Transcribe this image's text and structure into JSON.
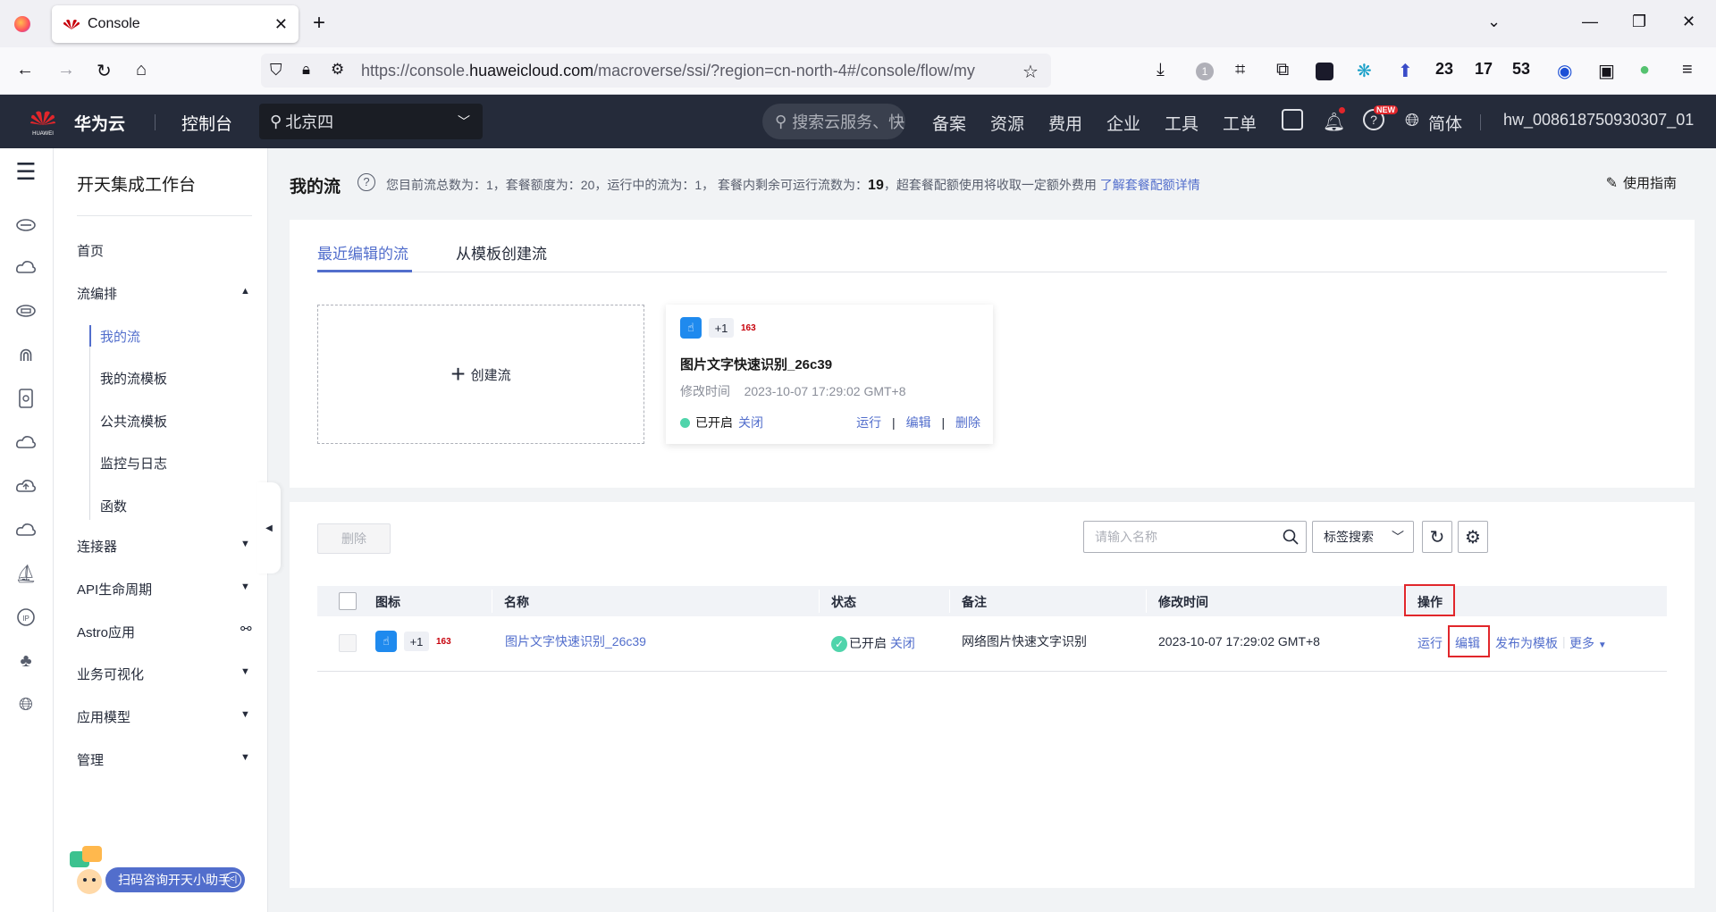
{
  "browser": {
    "tab_title": "Console",
    "url_prefix": "https://console.",
    "url_domain": "huaweicloud.com",
    "url_rest": "/macroverse/ssi/?region=cn-north-4#/console/flow/my",
    "ext_counts": [
      "23",
      "17",
      "53"
    ]
  },
  "header": {
    "brand": "华为云",
    "logo_text": "HUAWEI",
    "console": "控制台",
    "region": "北京四",
    "search_placeholder": "搜索云服务、快",
    "nav": [
      "备案",
      "资源",
      "费用",
      "企业",
      "工具",
      "工单"
    ],
    "new_badge": "NEW",
    "language": "简体",
    "username": "hw_008618750930307_01"
  },
  "menu": {
    "title": "开天集成工作台",
    "items": {
      "home": "首页",
      "orchestration": "流编排",
      "my_flows": "我的流",
      "my_templates": "我的流模板",
      "public_templates": "公共流模板",
      "monitor": "监控与日志",
      "functions": "函数",
      "connectors": "连接器",
      "api_lifecycle": "API生命周期",
      "astro": "Astro应用",
      "biz_visual": "业务可视化",
      "app_model": "应用模型",
      "manage": "管理"
    },
    "helper": "扫码咨询开天小助手"
  },
  "page": {
    "title": "我的流",
    "quota_text": "您目前流总数为：1，套餐额度为：20，运行中的流为：1，  套餐内剩余可运行流数为：",
    "quota_remaining": "19",
    "quota_tail": "，超套餐配额使用将收取一定额外费用",
    "quota_link": "了解套餐配额详情",
    "guide": "使用指南"
  },
  "tabs": {
    "recent": "最近编辑的流",
    "from_template": "从模板创建流"
  },
  "create_card": {
    "plus": "+",
    "label": "创建流"
  },
  "flow_card": {
    "plus_count": "+1",
    "badge": "163",
    "name": "图片文字快速识别_26c39",
    "time_label": "修改时间",
    "time_value": "2023-10-07 17:29:02 GMT+8",
    "status": "已开启",
    "toggle": "关闭",
    "run": "运行",
    "edit": "编辑",
    "delete": "删除",
    "sep": "|"
  },
  "table": {
    "delete_btn": "删除",
    "search_placeholder": "请输入名称",
    "tag_search": "标签搜索",
    "columns": {
      "icon": "图标",
      "name": "名称",
      "status": "状态",
      "note": "备注",
      "modified": "修改时间",
      "actions": "操作"
    },
    "row": {
      "plus_count": "+1",
      "badge": "163",
      "name": "图片文字快速识别_26c39",
      "status": "已开启",
      "toggle": "关闭",
      "note": "网络图片快速文字识别",
      "modified": "2023-10-07 17:29:02 GMT+8",
      "run": "运行",
      "edit": "编辑",
      "publish": "发布为模板",
      "more": "更多"
    }
  },
  "colors": {
    "accent": "#526ecc",
    "header_bg": "#252b3a",
    "status_green": "#50d4ab",
    "highlight_red": "#e1262b"
  }
}
